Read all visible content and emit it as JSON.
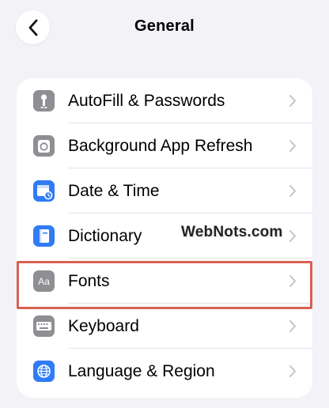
{
  "header": {
    "title": "General",
    "back_icon": "chevron-left-icon"
  },
  "settings": {
    "items": [
      {
        "label": "AutoFill & Passwords",
        "icon": "key-icon",
        "icon_color": "#8e8e93"
      },
      {
        "label": "Background App Refresh",
        "icon": "refresh-icon",
        "icon_color": "#8e8e93"
      },
      {
        "label": "Date & Time",
        "icon": "calendar-clock-icon",
        "icon_color": "#2f7cf6"
      },
      {
        "label": "Dictionary",
        "icon": "book-icon",
        "icon_color": "#2f7cf6"
      },
      {
        "label": "Fonts",
        "icon": "fonts-icon",
        "icon_color": "#8e8e93"
      },
      {
        "label": "Keyboard",
        "icon": "keyboard-icon",
        "icon_color": "#8e8e93"
      },
      {
        "label": "Language & Region",
        "icon": "globe-icon",
        "icon_color": "#2f7cf6"
      }
    ],
    "highlighted_item": "Fonts"
  },
  "watermark": "WebNots.com",
  "colors": {
    "background": "#f2f2f7",
    "card": "#ffffff",
    "chevron": "#c4c4c7",
    "highlight_border": "#d86050",
    "separator": "#e3e3e8"
  }
}
